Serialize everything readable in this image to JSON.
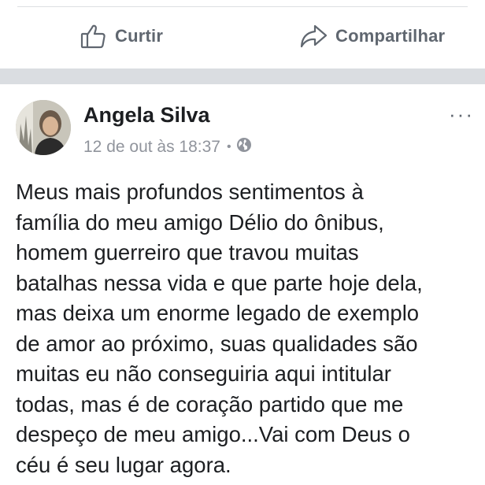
{
  "previous_post": {
    "actions": {
      "like_label": "Curtir",
      "share_label": "Compartilhar",
      "like_icon": "thumbs-up-icon",
      "share_icon": "share-arrow-icon"
    }
  },
  "post": {
    "author_name": "Angela Silva",
    "timestamp": "12 de out às 18:37",
    "separator": "•",
    "audience_icon": "globe-icon",
    "more_options": "···",
    "body_lines": [
      "Meus mais profundos sentimentos à",
      "família do meu amigo Délio do ônibus,",
      "homem guerreiro que travou muitas",
      "batalhas nessa vida e que parte hoje dela,",
      "mas deixa um enorme legado de exemplo",
      "de amor ao próximo, suas qualidades são",
      "muitas eu não conseguiria aqui intitular",
      "todas, mas é de coração partido que me",
      "despeço de meu amigo...Vai com Deus o",
      "céu é seu lugar agora."
    ]
  },
  "colors": {
    "text_primary": "#1c1e21",
    "text_secondary": "#90949c",
    "action_gray": "#606770",
    "separator_gray": "#dadde1"
  }
}
